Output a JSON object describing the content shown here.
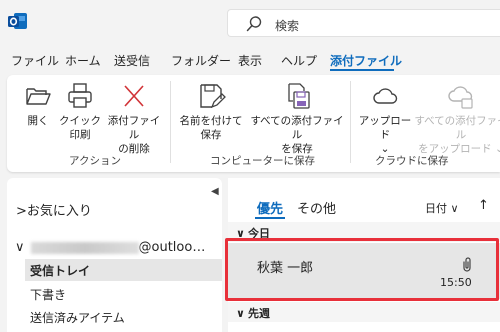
{
  "search": {
    "placeholder": "検索"
  },
  "menu": {
    "items": [
      "ファイル",
      "ホーム",
      "送受信",
      "フォルダー",
      "表示",
      "ヘルプ",
      "添付ファイル"
    ],
    "active_index": 6
  },
  "ribbon": {
    "groups": [
      {
        "label": "アクション",
        "buttons": [
          {
            "line1": "開く",
            "line2": "",
            "icon": "folder-open-icon",
            "disabled": false
          },
          {
            "line1": "クイック",
            "line2": "印刷",
            "icon": "printer-icon",
            "disabled": false
          },
          {
            "line1": "添付ファイル",
            "line2": "の削除",
            "icon": "delete-x-icon",
            "disabled": false
          }
        ]
      },
      {
        "label": "コンピューターに保存",
        "buttons": [
          {
            "line1": "名前を付けて",
            "line2": "保存",
            "icon": "save-as-icon",
            "disabled": false
          },
          {
            "line1": "すべての添付ファイル",
            "line2": "を保存",
            "icon": "save-all-icon",
            "disabled": false
          }
        ]
      },
      {
        "label": "クラウドに保存",
        "buttons": [
          {
            "line1": "アップロード",
            "line2": "⌄",
            "icon": "cloud-upload-icon",
            "disabled": false
          },
          {
            "line1": "すべての添付ファイル",
            "line2": "をアップロード ⌄",
            "icon": "cloud-upload-all-icon",
            "disabled": true
          }
        ]
      }
    ]
  },
  "folders": {
    "favorites_label": "お気に入り",
    "account_suffix": "@outloo…",
    "items": [
      "受信トレイ",
      "下書き",
      "送信済みアイテム"
    ],
    "selected_index": 0
  },
  "list": {
    "tab_focused": "優先",
    "tab_other": "その他",
    "sort_label": "日付",
    "groups": [
      "今日",
      "先週"
    ],
    "message": {
      "sender": "秋葉 一郎",
      "time": "15:50",
      "has_attachment": true
    }
  },
  "colors": {
    "accent": "#0f6cbd",
    "highlight": "#e8303a",
    "selected_bg": "#e6e6e6"
  }
}
